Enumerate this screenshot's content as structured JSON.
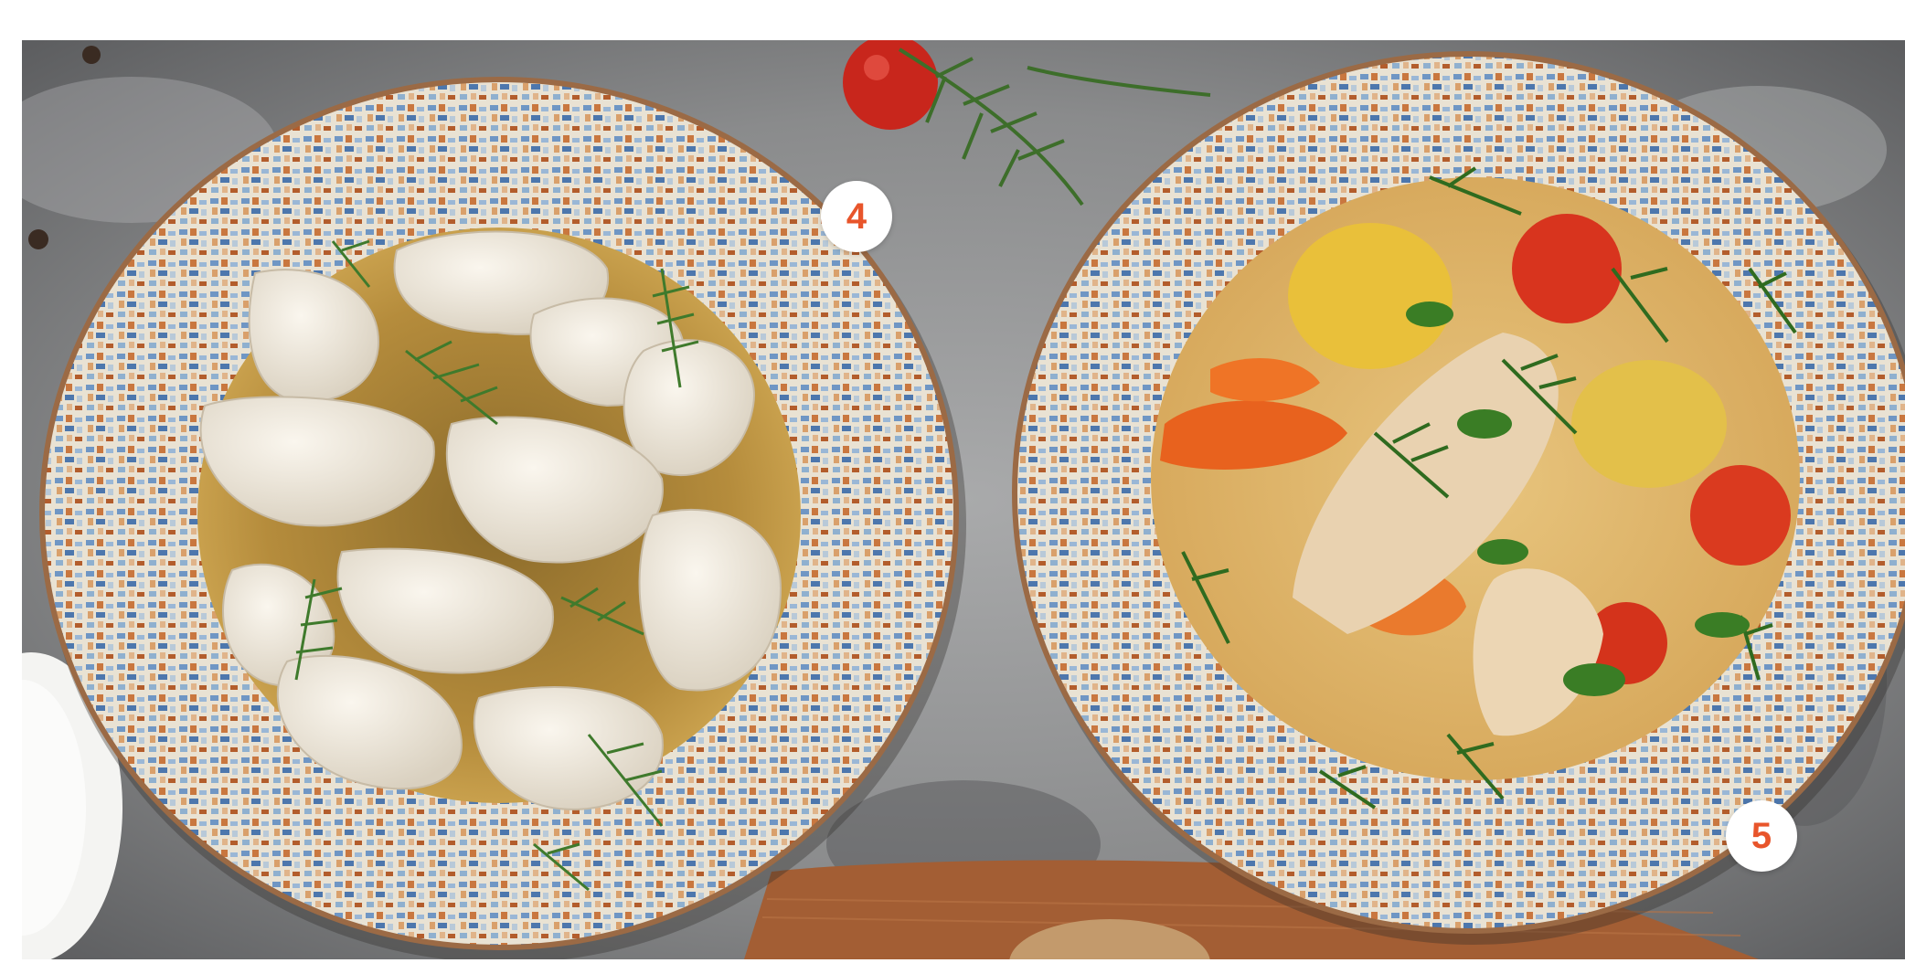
{
  "badges": [
    {
      "label": "4",
      "color": "#e8552b"
    },
    {
      "label": "5",
      "color": "#e8552b"
    }
  ],
  "colors": {
    "background": "#ffffff",
    "table_surface": "#8d8e8f",
    "badge_text": "#e8552b",
    "broth_clear": "#c9a04a",
    "broth_vegetable": "#e7c27a",
    "napkin": "#a35e34"
  },
  "scene": {
    "left_bowl_contents": "dumplings-in-broth",
    "right_bowl_contents": "chicken-vegetable-soup"
  }
}
